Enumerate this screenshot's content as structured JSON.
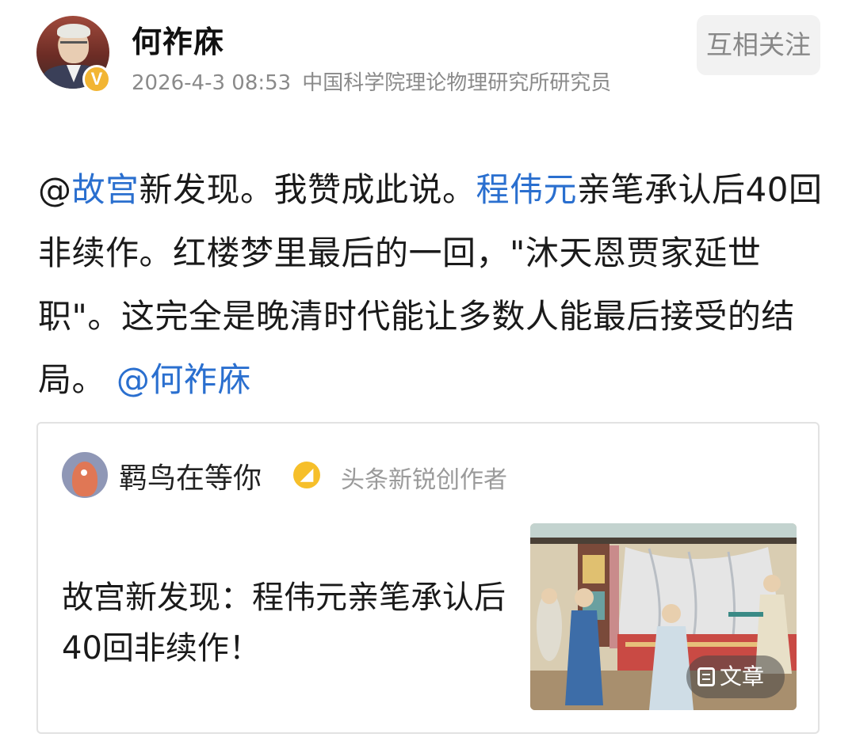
{
  "header": {
    "author_name": "何祚庥",
    "timestamp": "2026-4-3 08:53",
    "description": "中国科学院理论物理研究所研究员",
    "verified_badge": "V",
    "follow_label": "互相关注"
  },
  "post": {
    "mention_prefix": "@",
    "mention_1": "故宫",
    "text_1": "新发现。我赞成此说。",
    "mention_2": "程伟元",
    "text_2": "亲笔承认后40回非续作。红楼梦里最后的一回，\"沐天恩贾家延世职\"。这完全是晚清时代能让多数人能最后接受的结局。",
    "mention_3": "@何祚庥"
  },
  "quoted_card": {
    "author_name": "羁鸟在等你",
    "creator_badge": "◢",
    "author_role": "头条新锐创作者",
    "title": "故宫新发现：程伟元亲笔承认后40回非续作！",
    "tag_label": "文章"
  },
  "colors": {
    "mention": "#2a6fcf",
    "meta_text": "#8a8a8a",
    "badge_gold": "#f2b533"
  },
  "icons": {
    "verified": "verified-v-icon",
    "creator": "creator-badge-icon",
    "article": "document-icon"
  }
}
